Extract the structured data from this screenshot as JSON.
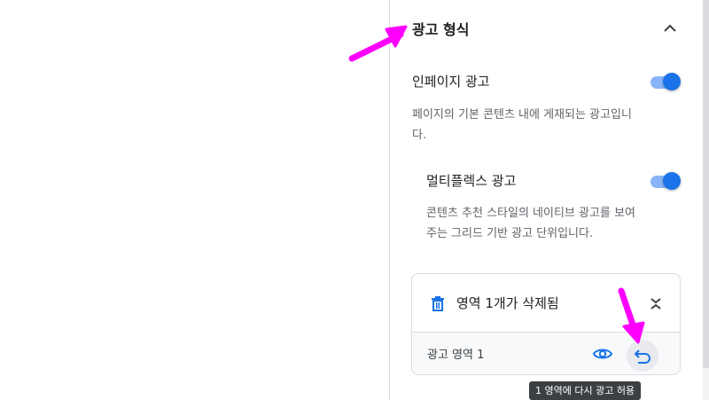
{
  "panel": {
    "section_title": "광고 형식",
    "inpage": {
      "label": "인페이지 광고",
      "enabled": true,
      "description": "페이지의 기본 콘텐츠 내에 게재되는 광고입니다."
    },
    "multiplex": {
      "label": "멀티플렉스 광고",
      "enabled": true,
      "description": "콘텐츠 추천 스타일의 네이티브 광고를 보여 주는 그리드 기반 광고 단위입니다."
    },
    "removed_card": {
      "title": "영역 1개가 삭제됨",
      "item_label": "광고 영역 1",
      "ghost_text": "광고 영역 1"
    }
  },
  "tooltip": "1 영역에 다시 광고 허용",
  "colors": {
    "accent": "#1a73e8",
    "toggle_track": "#8ab4f8",
    "annotation_arrow": "#ff00ff",
    "tooltip_bg": "#3c4043"
  },
  "icons": {
    "collapse": "chevron-up-icon",
    "trash": "trash-icon",
    "expand": "unfold-icon",
    "preview": "eye-icon",
    "undo": "undo-icon"
  }
}
